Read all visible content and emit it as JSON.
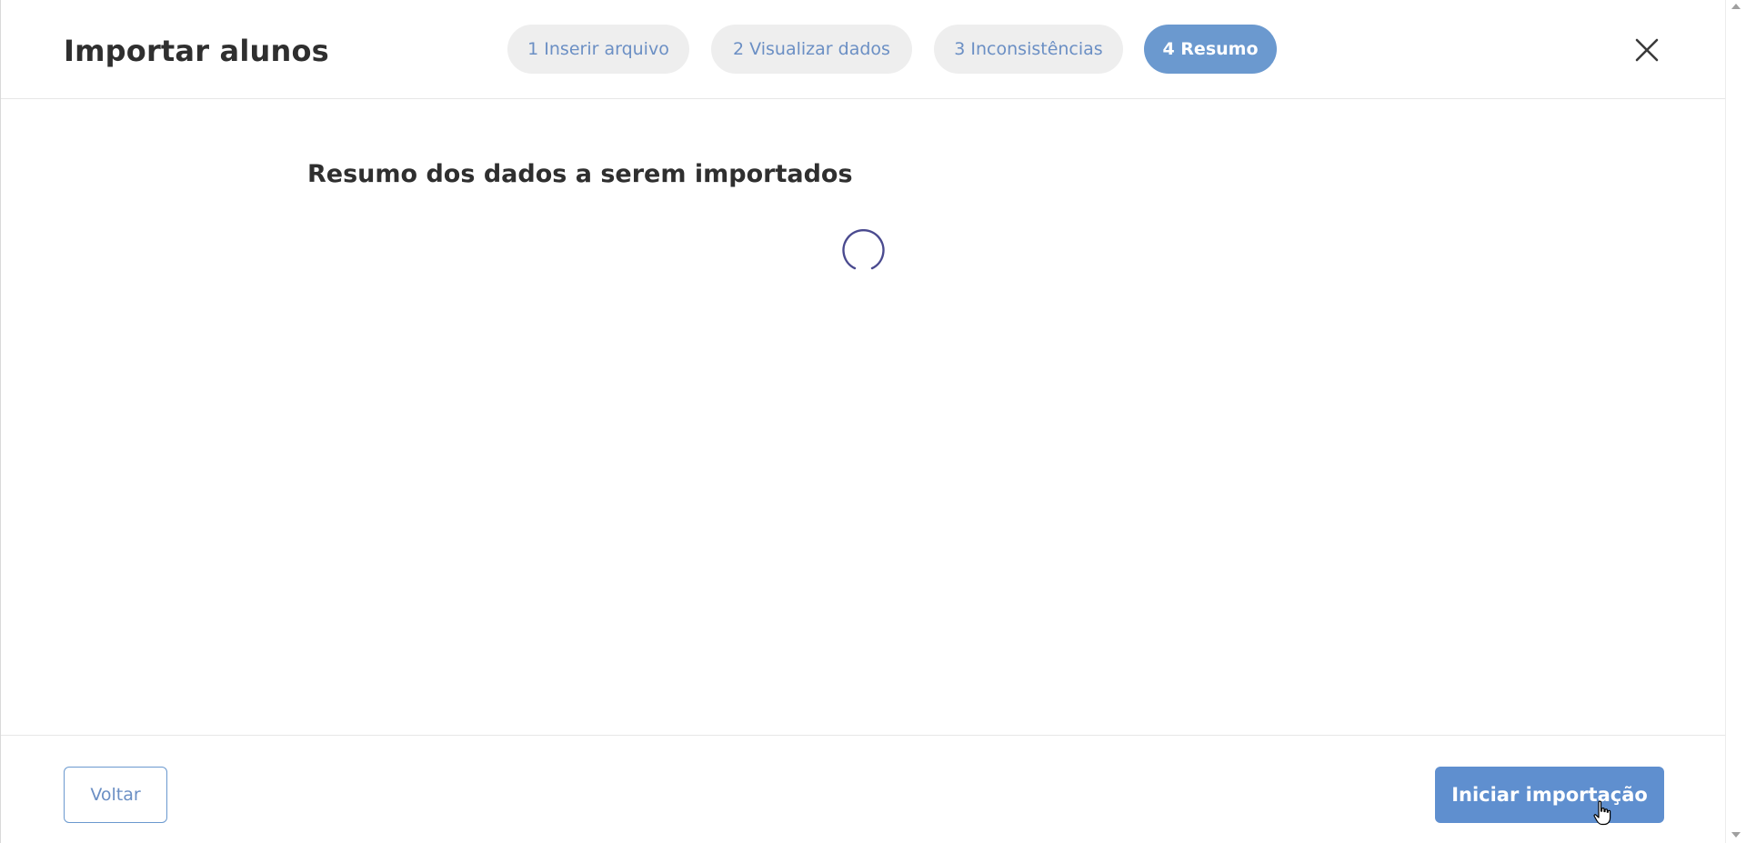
{
  "header": {
    "title": "Importar alunos",
    "steps": [
      {
        "label": "1 Inserir arquivo",
        "active": false
      },
      {
        "label": "2 Visualizar dados",
        "active": false
      },
      {
        "label": "3 Inconsistências",
        "active": false
      },
      {
        "label": "4 Resumo",
        "active": true
      }
    ],
    "close_icon": "close-icon"
  },
  "main": {
    "section_title": "Resumo dos dados a serem importados",
    "loading_icon": "loading-spinner-icon"
  },
  "footer": {
    "back_label": "Voltar",
    "start_label": "Iniciar importação"
  },
  "colors": {
    "accent": "#6b99cf",
    "primary_button": "#5f8fcf",
    "inactive_step_bg": "#eeeeee",
    "inactive_step_text": "#6b8fc4",
    "spinner": "#4a4a8f",
    "text": "#2f2f2f"
  }
}
